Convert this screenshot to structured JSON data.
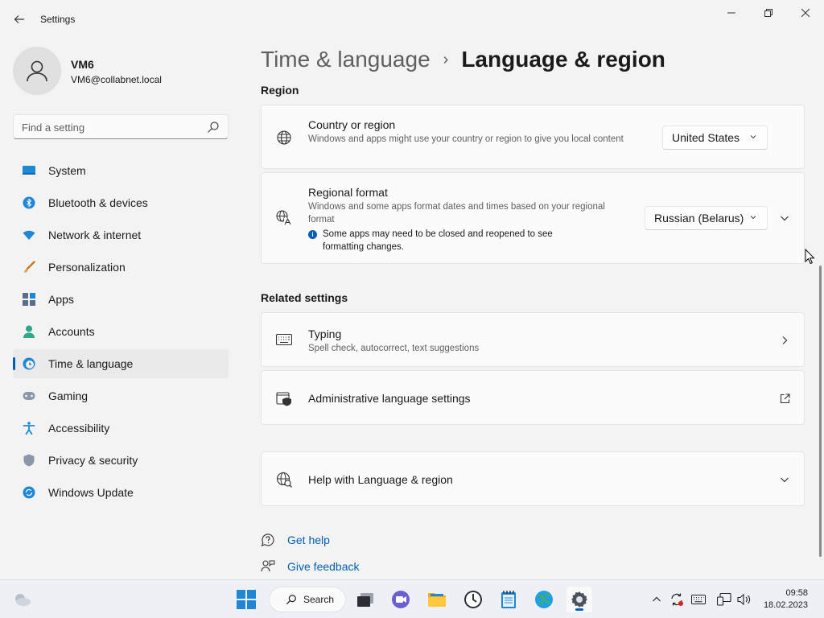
{
  "window": {
    "app_title": "Settings"
  },
  "profile": {
    "name": "VM6",
    "email": "VM6@collabnet.local"
  },
  "search": {
    "placeholder": "Find a setting"
  },
  "sidebar": {
    "items": [
      {
        "label": "System",
        "icon": "system-icon"
      },
      {
        "label": "Bluetooth & devices",
        "icon": "bluetooth-icon"
      },
      {
        "label": "Network & internet",
        "icon": "wifi-icon"
      },
      {
        "label": "Personalization",
        "icon": "brush-icon"
      },
      {
        "label": "Apps",
        "icon": "apps-icon"
      },
      {
        "label": "Accounts",
        "icon": "person-icon"
      },
      {
        "label": "Time & language",
        "icon": "globe-clock-icon",
        "active": true
      },
      {
        "label": "Gaming",
        "icon": "gamepad-icon"
      },
      {
        "label": "Accessibility",
        "icon": "accessibility-icon"
      },
      {
        "label": "Privacy & security",
        "icon": "shield-icon"
      },
      {
        "label": "Windows Update",
        "icon": "update-icon"
      }
    ]
  },
  "breadcrumb": {
    "parent": "Time & language",
    "separator": "›",
    "current": "Language & region"
  },
  "region_section": {
    "title": "Region",
    "country": {
      "title": "Country or region",
      "description": "Windows and apps might use your country or region to give you local content",
      "value": "United States"
    },
    "format": {
      "title": "Regional format",
      "description": "Windows and some apps format dates and times based on your regional format",
      "info": "Some apps may need to be closed and reopened to see formatting changes.",
      "value": "Russian (Belarus)"
    }
  },
  "related_section": {
    "title": "Related settings",
    "typing": {
      "title": "Typing",
      "description": "Spell check, autocorrect, text suggestions"
    },
    "admin": {
      "title": "Administrative language settings"
    }
  },
  "help_card": {
    "title": "Help with Language & region"
  },
  "links": {
    "get_help": "Get help",
    "give_feedback": "Give feedback"
  },
  "taskbar": {
    "search_label": "Search",
    "time": "09:58",
    "date": "18.02.2023"
  },
  "colors": {
    "accent": "#005fb8",
    "background": "#f3f3f3",
    "card": "#fbfbfb"
  }
}
